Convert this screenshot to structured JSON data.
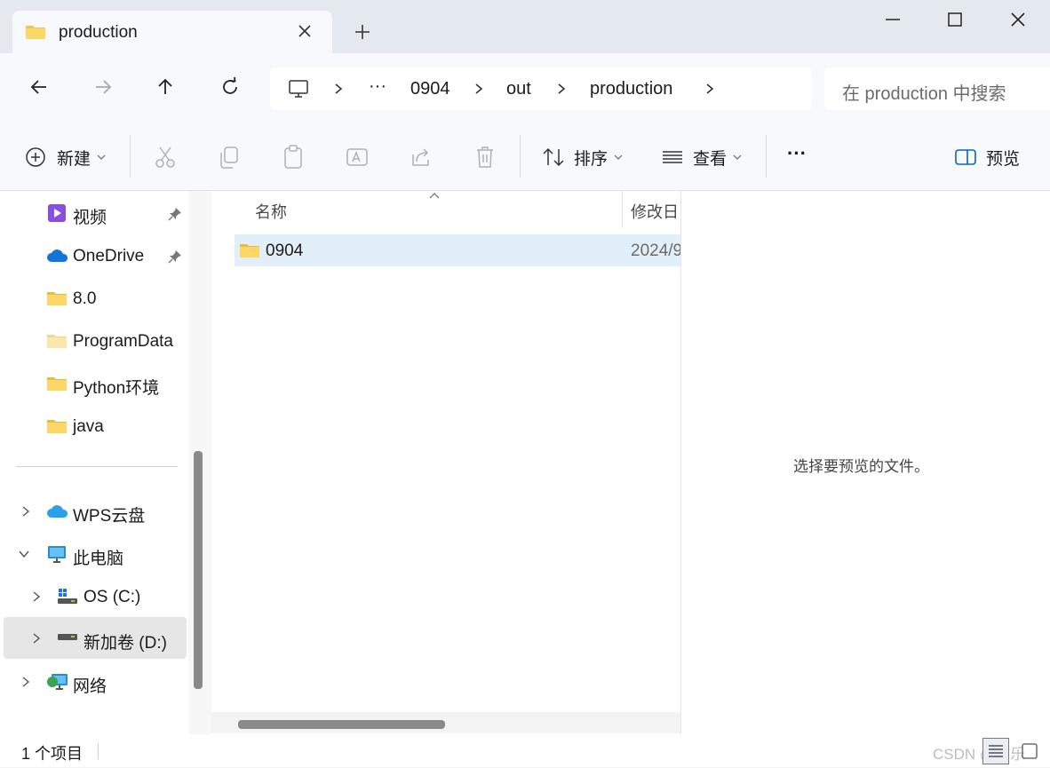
{
  "tab": {
    "title": "production",
    "folder_icon": "folder-icon"
  },
  "address": {
    "crumbs": [
      "0904",
      "out",
      "production"
    ],
    "ellipsis": "···"
  },
  "search": {
    "placeholder": "在 production 中搜索"
  },
  "toolbar": {
    "new_label": "新建",
    "sort_label": "排序",
    "view_label": "查看",
    "more_label": "···",
    "preview_label": "预览"
  },
  "sidebar": {
    "items": [
      {
        "label": "视频",
        "icon": "video-folder-icon",
        "pinned": true
      },
      {
        "label": "OneDrive",
        "icon": "cloud-icon",
        "pinned": true
      },
      {
        "label": "8.0",
        "icon": "folder-icon"
      },
      {
        "label": "ProgramData",
        "icon": "folder-icon"
      },
      {
        "label": "Python环境",
        "icon": "folder-icon"
      },
      {
        "label": "java",
        "icon": "folder-icon"
      }
    ],
    "tree": [
      {
        "label": "WPS云盘",
        "icon": "cloud-icon",
        "expander": "collapsed"
      },
      {
        "label": "此电脑",
        "icon": "computer-icon",
        "expander": "expanded"
      },
      {
        "label": "OS (C:)",
        "icon": "drive-icon",
        "expander": "collapsed"
      },
      {
        "label": "新加卷 (D:)",
        "icon": "drive-icon",
        "expander": "collapsed",
        "selected": true
      },
      {
        "label": "网络",
        "icon": "network-icon",
        "expander": "collapsed"
      }
    ]
  },
  "list": {
    "columns": [
      "名称",
      "修改日"
    ],
    "rows": [
      {
        "name": "0904",
        "modified": "2024/9"
      }
    ]
  },
  "preview": {
    "message": "选择要预览的文件。"
  },
  "status": {
    "count": "1 个项目",
    "watermark": "CSDN @三乐"
  },
  "colors": {
    "accent": "#0067c0",
    "selected_row": "#e1effa",
    "folder": "#f8c44a"
  }
}
